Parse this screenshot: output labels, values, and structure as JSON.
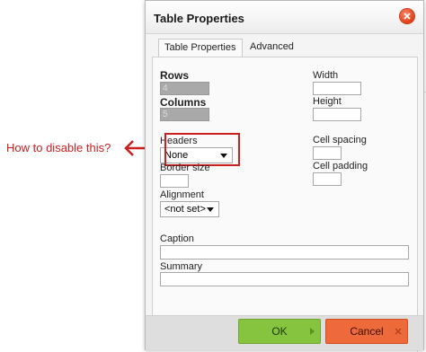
{
  "annotation": {
    "text": "How to disable this?",
    "color": "#cc1f1f"
  },
  "dialog": {
    "title": "Table Properties",
    "close_icon": "close-icon"
  },
  "tabs": [
    {
      "label": "Table Properties",
      "active": true
    },
    {
      "label": "Advanced",
      "active": false
    }
  ],
  "fields": {
    "rows": {
      "label": "Rows",
      "value": "4"
    },
    "columns": {
      "label": "Columns",
      "value": "5"
    },
    "width": {
      "label": "Width",
      "value": ""
    },
    "height": {
      "label": "Height",
      "value": ""
    },
    "headers": {
      "label": "Headers",
      "value": "None"
    },
    "cell_spacing": {
      "label": "Cell spacing",
      "value": ""
    },
    "cell_padding": {
      "label": "Cell padding",
      "value": ""
    },
    "border_size": {
      "label": "Border size",
      "value": ""
    },
    "alignment": {
      "label": "Alignment",
      "value": "<not set>"
    },
    "caption": {
      "label": "Caption",
      "value": ""
    },
    "summary": {
      "label": "Summary",
      "value": ""
    }
  },
  "buttons": {
    "ok": "OK",
    "cancel": "Cancel"
  },
  "colors": {
    "ok": "#86c43f",
    "cancel": "#ef6a3a",
    "highlight": "#cc1f1f"
  }
}
